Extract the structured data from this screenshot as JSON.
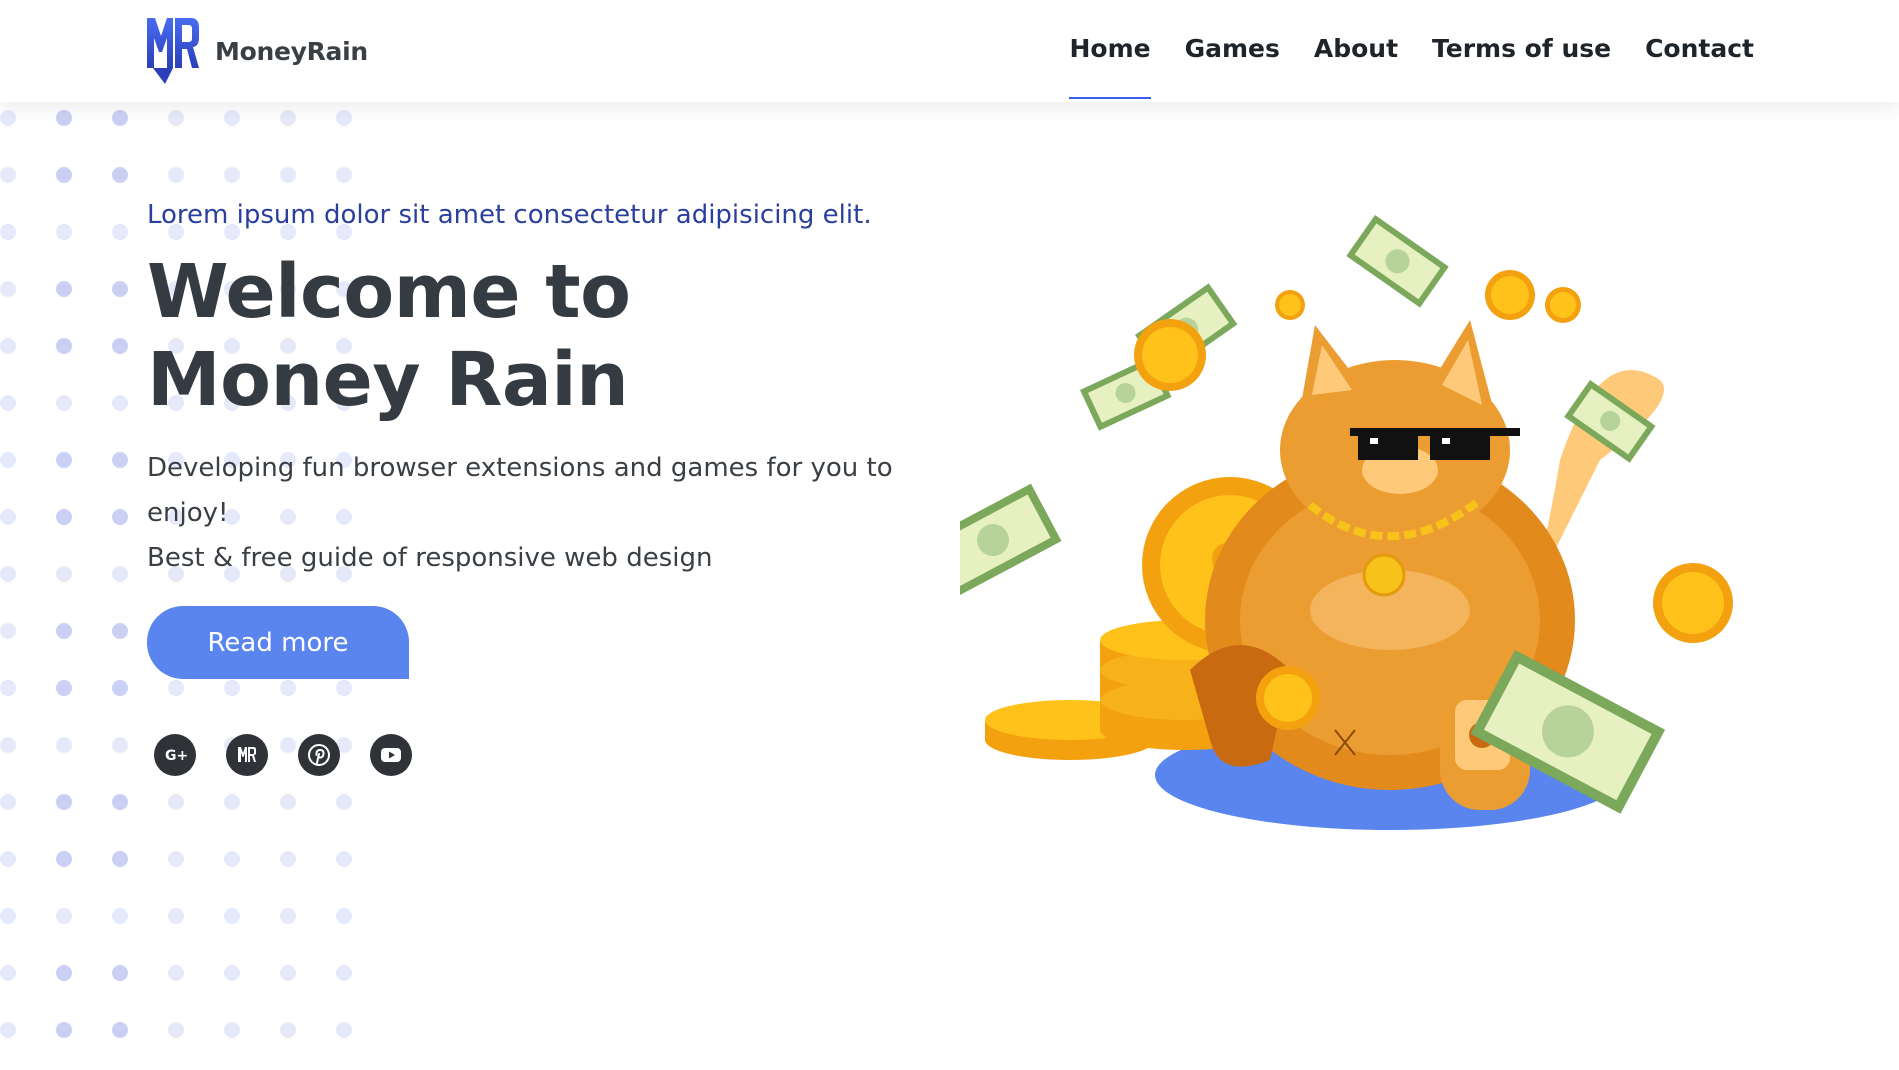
{
  "brand": {
    "name": "MoneyRain",
    "logo_icon": "mr-monogram-icon",
    "color": "#3d5cf0"
  },
  "nav": {
    "items": [
      {
        "label": "Home",
        "active": true
      },
      {
        "label": "Games",
        "active": false
      },
      {
        "label": "About",
        "active": false
      },
      {
        "label": "Terms of use",
        "active": false
      },
      {
        "label": "Contact",
        "active": false
      }
    ]
  },
  "hero": {
    "tagline": "Lorem ipsum dolor sit amet consectetur adipisicing elit.",
    "title_line1": "Welcome to",
    "title_line2": "Money Rain",
    "description_line1": "Developing fun browser extensions and games for you to enjoy!",
    "description_line2": "Best & free guide of responsive web design",
    "button_label": "Read more",
    "button_color": "#5b85ee"
  },
  "socials": [
    {
      "icon": "google-plus-icon"
    },
    {
      "icon": "moneyrain-icon"
    },
    {
      "icon": "pinterest-icon"
    },
    {
      "icon": "youtube-icon"
    }
  ],
  "illustration": {
    "icon": "cat-with-money-illustration"
  }
}
